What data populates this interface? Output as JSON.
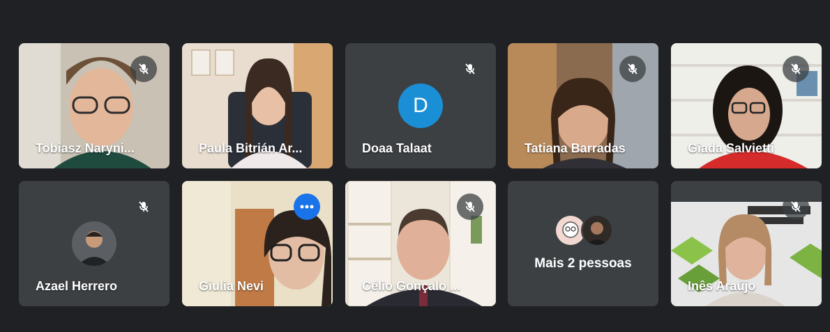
{
  "participants": [
    {
      "name": "Tobiasz Naryni...",
      "muted": true
    },
    {
      "name": "Paula Bitrián Ar...",
      "muted": false
    },
    {
      "name": "Doaa Talaat",
      "muted": true,
      "initial": "D"
    },
    {
      "name": "Tatiana Barradas",
      "muted": true
    },
    {
      "name": "Giada Salvietti",
      "muted": true
    },
    {
      "name": "Azael Herrero",
      "muted": true
    },
    {
      "name": "Giulia Nevi",
      "muted": false,
      "pinned_menu": true
    },
    {
      "name": "Célio Gonçalo ...",
      "muted": true
    },
    {
      "name": "Inês Araújo",
      "muted": true
    }
  ],
  "others": {
    "label": "Mais 2 pessoas"
  },
  "colors": {
    "background": "#202124",
    "tile": "#3c4043",
    "active_outline": "#8ab4f8",
    "avatar_d": "#1a8fd6",
    "menu_button": "#1a73e8"
  },
  "icons": {
    "mute": "mic-off-icon",
    "more": "more-options-icon"
  }
}
